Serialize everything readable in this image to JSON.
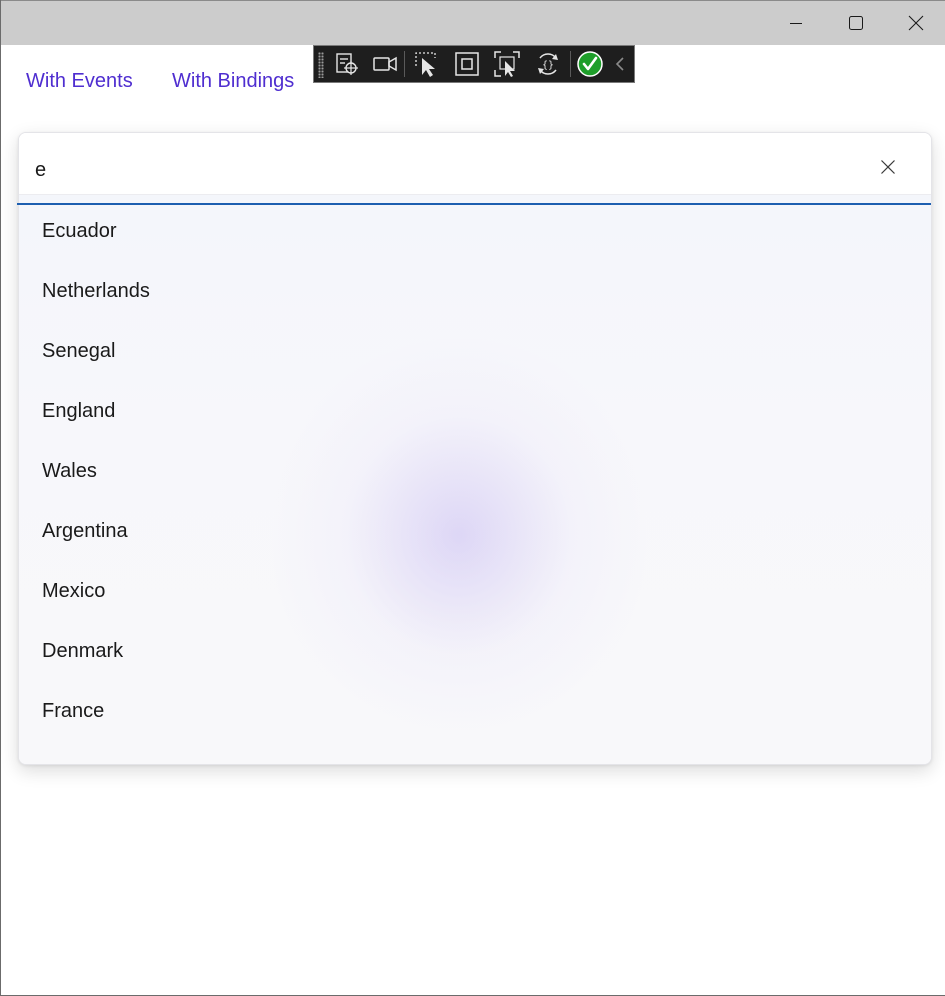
{
  "window": {
    "controls": [
      "minimize-icon",
      "maximize-icon",
      "close-icon"
    ]
  },
  "nav": {
    "with_events": "With Events",
    "with_bindings": "With Bindings"
  },
  "dev_toolbar": {
    "icons": [
      "select-element-icon",
      "record-icon",
      "pointer-select-icon",
      "layout-adorners-icon",
      "track-focus-icon",
      "hot-reload-icon",
      "binding-status-ok-icon",
      "collapse-chevron-icon"
    ],
    "status_color": "#1e9e2a"
  },
  "autosuggest": {
    "query": "e",
    "clear_icon": "close-icon",
    "suggestions": [
      "Ecuador",
      "Netherlands",
      "Senegal",
      "England",
      "Wales",
      "Argentina",
      "Mexico",
      "Denmark",
      "France"
    ]
  },
  "colors": {
    "link": "#4f2ed0",
    "focus_accent": "#1d5fb0",
    "titlebar": "#cccccc"
  }
}
